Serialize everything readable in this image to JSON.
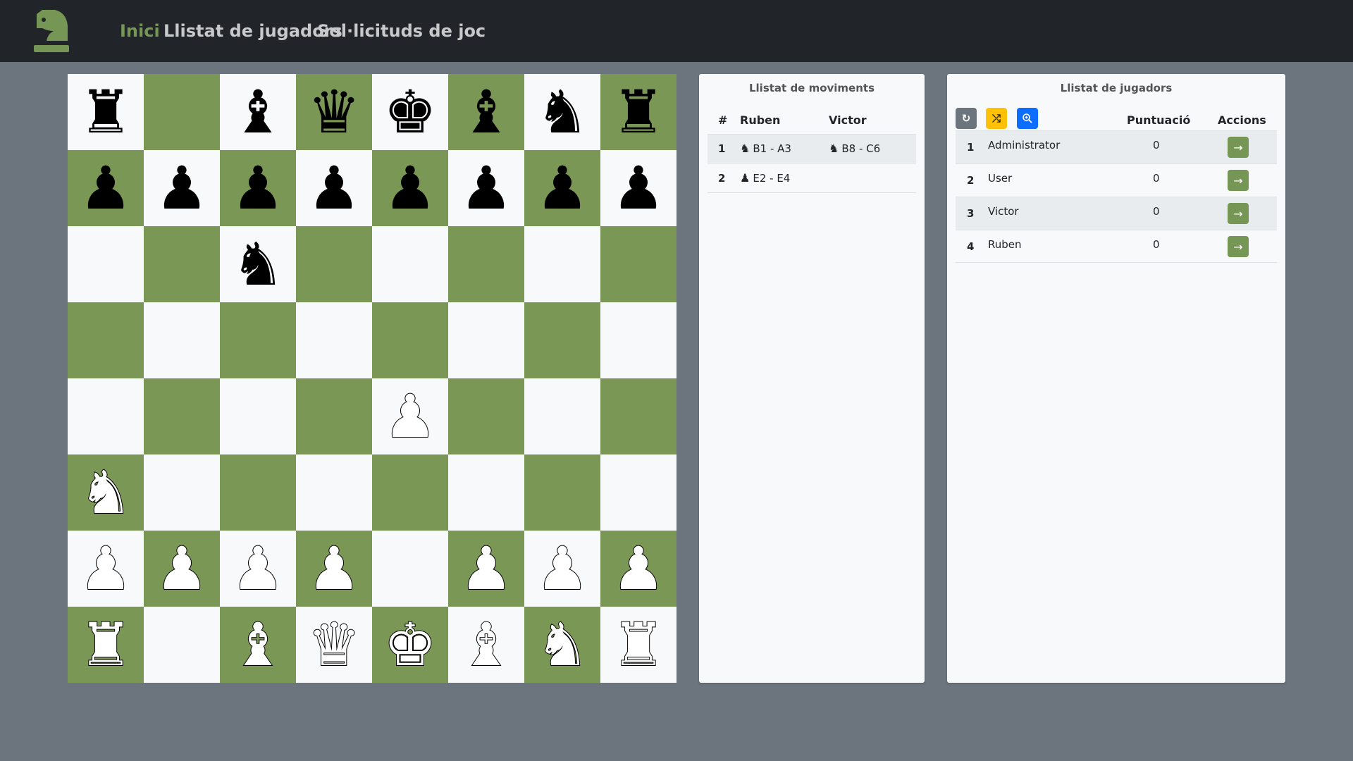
{
  "colors": {
    "accent": "#769656",
    "navbar": "#212529",
    "page_background": "#6c757d",
    "board_light": "#f8f9fa",
    "board_dark": "#7a9755"
  },
  "navbar": {
    "logo_icon": "chess-knight-icon",
    "links": [
      {
        "label": "Inici",
        "active": true
      },
      {
        "label": "Llistat de jugadors",
        "active": false
      },
      {
        "label": "Sol·licituds de joc",
        "active": false
      }
    ]
  },
  "board": {
    "ranks": [
      [
        "bR",
        "",
        "bB",
        "bQ",
        "bK",
        "bB",
        "bN",
        "bR"
      ],
      [
        "bP",
        "bP",
        "bP",
        "bP",
        "bP",
        "bP",
        "bP",
        "bP"
      ],
      [
        "",
        "",
        "bN",
        "",
        "",
        "",
        "",
        ""
      ],
      [
        "",
        "",
        "",
        "",
        "",
        "",
        "",
        ""
      ],
      [
        "",
        "",
        "",
        "",
        "wP",
        "",
        "",
        ""
      ],
      [
        "wN",
        "",
        "",
        "",
        "",
        "",
        "",
        ""
      ],
      [
        "wP",
        "wP",
        "wP",
        "wP",
        "",
        "wP",
        "wP",
        "wP"
      ],
      [
        "wR",
        "",
        "wB",
        "wQ",
        "wK",
        "wB",
        "wN",
        "wR"
      ]
    ]
  },
  "moves_panel": {
    "title": "Llistat de moviments",
    "headers": {
      "number": "#",
      "white": "Ruben",
      "black": "Victor"
    },
    "rows": [
      {
        "num": "1",
        "white_icon": "knight-icon",
        "white": "B1 - A3",
        "black_icon": "knight-icon",
        "black": "B8 - C6"
      },
      {
        "num": "2",
        "white_icon": "pawn-icon",
        "white": "E2 - E4",
        "black_icon": "",
        "black": ""
      }
    ]
  },
  "players_panel": {
    "title": "Llistat de jugadors",
    "buttons": [
      {
        "icon": "refresh-icon",
        "color": "#6c757d"
      },
      {
        "icon": "shuffle-icon",
        "color": "#ffc107"
      },
      {
        "icon": "zoom-in-icon",
        "color": "#0d6efd"
      }
    ],
    "headers": {
      "score": "Puntuació",
      "actions": "Accions"
    },
    "rows": [
      {
        "rank": "1",
        "name": "Administrator",
        "score": "0",
        "action_icon": "arrow-right-icon"
      },
      {
        "rank": "2",
        "name": "User",
        "score": "0",
        "action_icon": "arrow-right-icon"
      },
      {
        "rank": "3",
        "name": "Victor",
        "score": "0",
        "action_icon": "arrow-right-icon"
      },
      {
        "rank": "4",
        "name": "Ruben",
        "score": "0",
        "action_icon": "arrow-right-icon"
      }
    ]
  }
}
